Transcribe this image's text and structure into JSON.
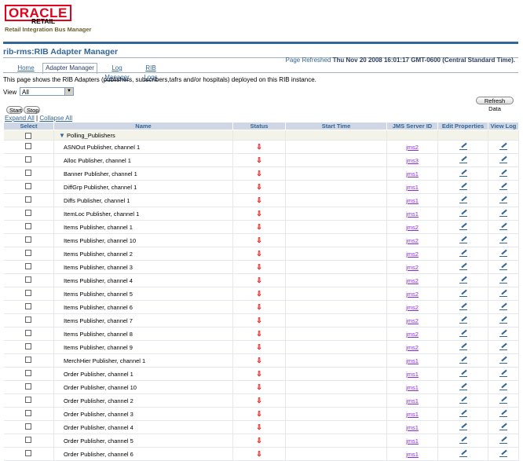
{
  "brand": {
    "logo": "ORACLE",
    "product": "RETAIL",
    "app": "Retail Integration Bus Manager"
  },
  "page": {
    "title": "rib-rms:RIB Adapter Manager",
    "refreshed_label": "Page Refreshed",
    "refreshed_value": "Thu Nov 20 2008 16:01:17 GMT-0600 (Central Standard Time).",
    "description": "This page shows the RIB Adapters (publishers, subscribers,tafrs and/or hospitals) deployed on this RIB instance."
  },
  "tabs": [
    {
      "label": "Home"
    },
    {
      "label": "Adapter Manager"
    },
    {
      "label": "Log Manager"
    },
    {
      "label": "RIB Logs"
    }
  ],
  "view": {
    "label": "View",
    "value": "All"
  },
  "buttons": {
    "start": "Start",
    "stop": "Stop",
    "refresh": "Refresh Data"
  },
  "links": {
    "expand_all": "Expand All",
    "separator": "|",
    "collapse_all": "Collapse All"
  },
  "table": {
    "headers": {
      "select": "Select",
      "name": "Name",
      "status": "Status",
      "start_time": "Start Time",
      "jms": "JMS Server ID",
      "edit": "Edit Properties",
      "log": "View Log"
    },
    "group": "Polling_Publishers",
    "rows": [
      {
        "name": "ASNOut Publisher, channel 1",
        "jms": "jms2"
      },
      {
        "name": "Alloc Publisher, channel 1",
        "jms": "jms3"
      },
      {
        "name": "Banner Publisher, channel 1",
        "jms": "jms1"
      },
      {
        "name": "DiffGrp Publisher, channel 1",
        "jms": "jms1"
      },
      {
        "name": "Diffs Publisher, channel 1",
        "jms": "jms1"
      },
      {
        "name": "ItemLoc Publisher, channel 1",
        "jms": "jms1"
      },
      {
        "name": "Items Publisher, channel 1",
        "jms": "jms2"
      },
      {
        "name": "Items Publisher, channel 10",
        "jms": "jms2"
      },
      {
        "name": "Items Publisher, channel 2",
        "jms": "jms2"
      },
      {
        "name": "Items Publisher, channel 3",
        "jms": "jms2"
      },
      {
        "name": "Items Publisher, channel 4",
        "jms": "jms2"
      },
      {
        "name": "Items Publisher, channel 5",
        "jms": "jms2"
      },
      {
        "name": "Items Publisher, channel 6",
        "jms": "jms2"
      },
      {
        "name": "Items Publisher, channel 7",
        "jms": "jms2"
      },
      {
        "name": "Items Publisher, channel 8",
        "jms": "jms2"
      },
      {
        "name": "Items Publisher, channel 9",
        "jms": "jms2"
      },
      {
        "name": "MerchHier Publisher, channel 1",
        "jms": "jms1"
      },
      {
        "name": "Order Publisher, channel 1",
        "jms": "jms1"
      },
      {
        "name": "Order Publisher, channel 10",
        "jms": "jms1"
      },
      {
        "name": "Order Publisher, channel 2",
        "jms": "jms1"
      },
      {
        "name": "Order Publisher, channel 3",
        "jms": "jms1"
      },
      {
        "name": "Order Publisher, channel 4",
        "jms": "jms1"
      },
      {
        "name": "Order Publisher, channel 5",
        "jms": "jms1"
      },
      {
        "name": "Order Publisher, channel 6",
        "jms": "jms1"
      }
    ]
  },
  "colors": {
    "brand_red": "#e2001a",
    "accent_blue": "#336699",
    "status_down": "#e00000",
    "link_visited": "#8a2be2"
  },
  "icons": {
    "status": "down-arrow-icon",
    "edit": "pencil-icon",
    "log": "pencil-icon"
  }
}
